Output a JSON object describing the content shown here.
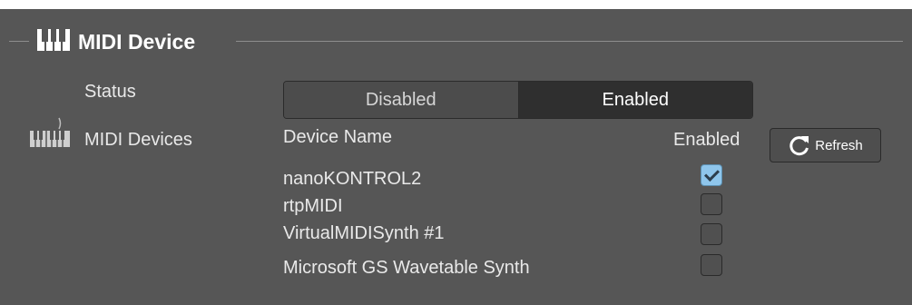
{
  "section": {
    "title": "MIDI Device",
    "icon": "piano-keys-icon"
  },
  "status": {
    "label": "Status",
    "options": [
      "Disabled",
      "Enabled"
    ],
    "selected": "Enabled"
  },
  "midi_devices": {
    "label": "MIDI Devices",
    "icon": "midi-keyboard-icon",
    "columns": {
      "name": "Device Name",
      "enabled": "Enabled"
    },
    "refresh_label": "Refresh",
    "items": [
      {
        "name": "nanoKONTROL2",
        "enabled": true
      },
      {
        "name": "rtpMIDI",
        "enabled": false
      },
      {
        "name": "VirtualMIDISynth #1",
        "enabled": false
      },
      {
        "name": "Microsoft GS Wavetable Synth",
        "enabled": false
      }
    ]
  },
  "colors": {
    "panel": "#565656",
    "checked": "#8fc6ec",
    "rule": "#8d8d8d"
  }
}
